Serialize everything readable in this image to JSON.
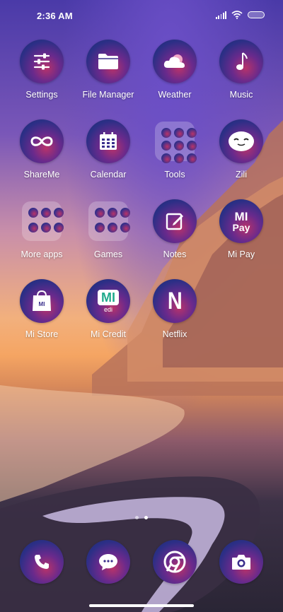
{
  "status_bar": {
    "time": "2:36 AM"
  },
  "apps": [
    {
      "label": "Settings",
      "icon": "sliders-icon"
    },
    {
      "label": "File Manager",
      "icon": "folder-icon"
    },
    {
      "label": "Weather",
      "icon": "cloud-icon"
    },
    {
      "label": "Music",
      "icon": "music-note-icon"
    },
    {
      "label": "ShareMe",
      "icon": "infinity-icon"
    },
    {
      "label": "Calendar",
      "icon": "calendar-icon"
    },
    {
      "label": "Tools",
      "icon": "folder-icon"
    },
    {
      "label": "Zili",
      "icon": "face-icon"
    },
    {
      "label": "More apps",
      "icon": "folder-icon"
    },
    {
      "label": "Games",
      "icon": "folder-icon"
    },
    {
      "label": "Notes",
      "icon": "note-edit-icon"
    },
    {
      "label": "Mi Pay",
      "icon": "mi-pay-icon"
    },
    {
      "label": "Mi Store",
      "icon": "shopping-bag-icon"
    },
    {
      "label": "Mi Credit",
      "icon": "mi-credit-icon"
    },
    {
      "label": "Netflix",
      "icon": "netflix-icon"
    }
  ],
  "dock": [
    {
      "icon": "phone-icon"
    },
    {
      "icon": "message-icon"
    },
    {
      "icon": "chrome-icon"
    },
    {
      "icon": "camera-icon"
    }
  ],
  "glyphs": {
    "mi": "MI",
    "pay": "Pay",
    "netflix": "N",
    "credit": "edi"
  }
}
